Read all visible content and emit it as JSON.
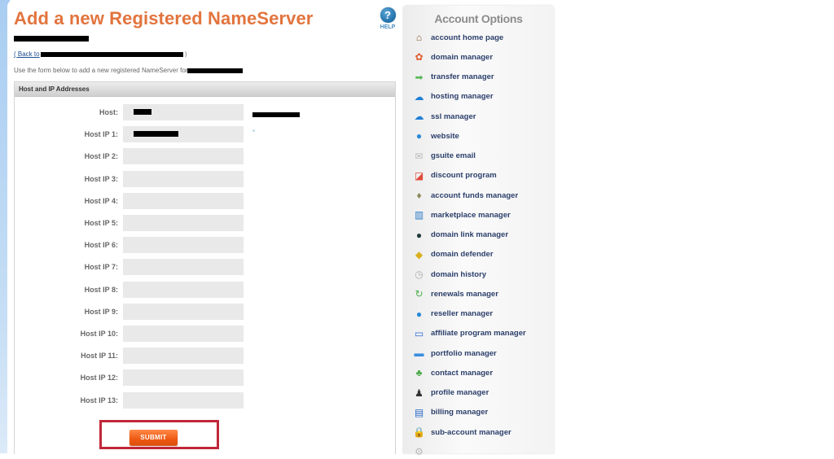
{
  "page": {
    "title": "Add a new Registered NameServer",
    "help_label": "HELP",
    "back_prefix": "( Back to",
    "back_suffix": ")",
    "instructions": "Use the form below to add a new registered NameServer for"
  },
  "form": {
    "section_title": "Host and IP Addresses",
    "fields": [
      {
        "label": "Host:",
        "value": "[redacted]"
      },
      {
        "label": "Host IP 1:",
        "value": "[redacted]"
      },
      {
        "label": "Host IP 2:",
        "value": ""
      },
      {
        "label": "Host IP 3:",
        "value": ""
      },
      {
        "label": "Host IP 4:",
        "value": ""
      },
      {
        "label": "Host IP 5:",
        "value": ""
      },
      {
        "label": "Host IP 6:",
        "value": ""
      },
      {
        "label": "Host IP 7:",
        "value": ""
      },
      {
        "label": "Host IP 8:",
        "value": ""
      },
      {
        "label": "Host IP 9:",
        "value": ""
      },
      {
        "label": "Host IP 10:",
        "value": ""
      },
      {
        "label": "Host IP 11:",
        "value": ""
      },
      {
        "label": "Host IP 12:",
        "value": ""
      },
      {
        "label": "Host IP 13:",
        "value": ""
      }
    ],
    "required_marker": "*",
    "submit_label": "SUBMIT"
  },
  "sidebar": {
    "title": "Account Options",
    "items": [
      {
        "label": "account home page",
        "icon": "house-icon"
      },
      {
        "label": "domain manager",
        "icon": "domain-manager-icon"
      },
      {
        "label": "transfer manager",
        "icon": "arrow-right-icon"
      },
      {
        "label": "hosting manager",
        "icon": "cloud-icon"
      },
      {
        "label": "ssl manager",
        "icon": "cloud-icon"
      },
      {
        "label": "website",
        "icon": "globe-icon"
      },
      {
        "label": "gsuite email",
        "icon": "envelope-icon"
      },
      {
        "label": "discount program",
        "icon": "tag-icon"
      },
      {
        "label": "account funds manager",
        "icon": "money-bag-icon"
      },
      {
        "label": "marketplace manager",
        "icon": "marketplace-icon"
      },
      {
        "label": "domain link manager",
        "icon": "dark-globe-icon"
      },
      {
        "label": "domain defender",
        "icon": "shield-icon"
      },
      {
        "label": "domain history",
        "icon": "clock-icon"
      },
      {
        "label": "renewals manager",
        "icon": "renew-icon"
      },
      {
        "label": "reseller manager",
        "icon": "globe-icon"
      },
      {
        "label": "affiliate program manager",
        "icon": "monitor-icon"
      },
      {
        "label": "portfolio manager",
        "icon": "folder-icon"
      },
      {
        "label": "contact manager",
        "icon": "contacts-icon"
      },
      {
        "label": "profile manager",
        "icon": "users-icon"
      },
      {
        "label": "billing manager",
        "icon": "credit-card-icon"
      },
      {
        "label": "sub-account manager",
        "icon": "lock-icon"
      }
    ]
  },
  "colors": {
    "title": "#e2743e",
    "menu_text": "#2b3f6b",
    "submit": "#ee5a14",
    "highlight_box": "#c0283a"
  }
}
